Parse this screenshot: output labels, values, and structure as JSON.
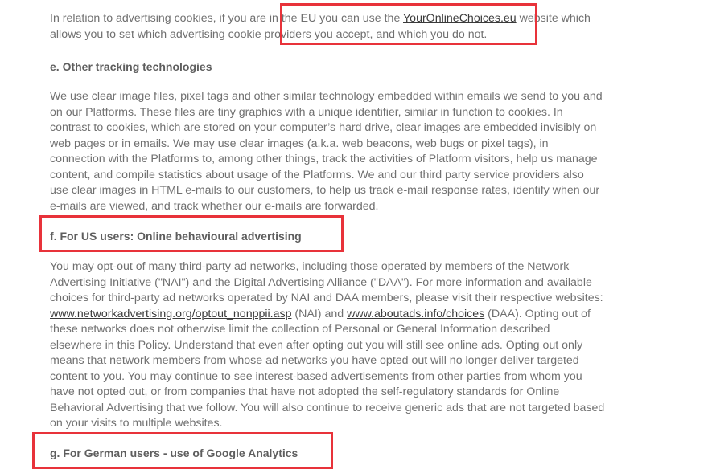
{
  "sections": {
    "eu_paragraph": {
      "text_before": "In relation to advertising cookies, if you are in the EU you can use the ",
      "link_text": "YourOnlineChoices.eu",
      "text_after": " website which allows you to set which advertising cookie providers you accept, and which you do not."
    },
    "heading_e": "e. Other tracking technologies",
    "tracking_paragraph": "We use clear image files, pixel tags and other similar technology embedded within emails we send to you and on our Platforms. These files are tiny graphics with a unique identifier, similar in function to cookies. In contrast to cookies, which are stored on your computer’s hard drive, clear images are embedded invisibly on web pages or in emails. We may use clear images (a.k.a. web beacons, web bugs or pixel tags), in connection with the Platforms to, among other things, track the activities of Platform visitors, help us manage content, and compile statistics about usage of the Platforms. We and our third party service providers also use clear images in HTML e-mails to our customers, to help us track e-mail response rates, identify when our e-mails are viewed, and track whether our e-mails are forwarded.",
    "heading_f": "f. For US users: Online behavioural advertising",
    "optout_paragraph": {
      "text_1": "You may opt-out of many third-party ad networks, including those operated by members of the Network Advertising Initiative (\"NAI\") and the Digital Advertising Alliance (\"DAA\"). For more information and available choices for third-party ad networks operated by NAI and DAA members, please visit their respective websites: ",
      "link_nai": "www.networkadvertising.org/optout_nonppii.asp",
      "text_2": " (NAI) and ",
      "link_daa": "www.aboutads.info/choices",
      "text_3": " (DAA). Opting out of these networks does not otherwise limit the collection of Personal or General Information described elsewhere in this Policy. Understand that even after opting out you will still see online ads. Opting out only means that network members from whose ad networks you have opted out will no longer deliver targeted content to you. You may continue to see interest-based advertisements from other parties from whom you have not opted out, or from companies that have not adopted the self-regulatory standards for Online Behavioral Advertising that we follow. You will also continue to receive generic ads that are not targeted based on your visits to multiple websites."
    },
    "heading_g": "g. For German users - use of Google Analytics"
  },
  "annotation_color": "#e8323a"
}
